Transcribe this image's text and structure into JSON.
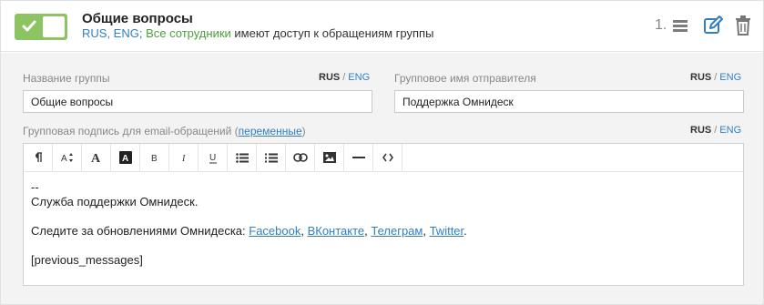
{
  "header": {
    "title": "Общие вопросы",
    "languages": "RUS, ENG;",
    "access_group": "Все сотрудники",
    "access_text": "имеют доступ к обращениям группы",
    "order": "1."
  },
  "form": {
    "group_name": {
      "label": "Название группы",
      "lang_active": "RUS",
      "lang_sep": "/",
      "lang_other": "ENG",
      "value": "Общие вопросы"
    },
    "sender_name": {
      "label": "Групповое имя отправителя",
      "lang_active": "RUS",
      "lang_sep": "/",
      "lang_other": "ENG",
      "value": "Поддержка Омнидеск"
    },
    "signature": {
      "label_prefix": "Групповая подпись для email-обращений (",
      "label_link": "переменные",
      "label_suffix": ")",
      "lang_active": "RUS",
      "lang_sep": "/",
      "lang_other": "ENG",
      "content": {
        "dashes": "--",
        "line1": "Служба поддержки Омнидеск.",
        "follow_text": "Следите за обновлениями Омнидеска: ",
        "links": [
          "Facebook",
          "ВКонтакте",
          "Телеграм",
          "Twitter"
        ],
        "separator": ", ",
        "end": ".",
        "variable": "[previous_messages]"
      }
    }
  },
  "toolbar": {
    "buttons": [
      {
        "name": "paragraph-icon",
        "glyph": "¶"
      },
      {
        "name": "font-size-icon",
        "glyph": "A↕"
      },
      {
        "name": "text-color-icon",
        "glyph": "A"
      },
      {
        "name": "background-color-icon",
        "glyph": "A"
      },
      {
        "name": "bold-icon",
        "glyph": "B"
      },
      {
        "name": "italic-icon",
        "glyph": "I"
      },
      {
        "name": "underline-icon",
        "glyph": "U"
      },
      {
        "name": "unordered-list-icon",
        "glyph": "☰"
      },
      {
        "name": "ordered-list-icon",
        "glyph": "☰"
      },
      {
        "name": "link-icon",
        "glyph": "🔗"
      },
      {
        "name": "image-icon",
        "glyph": "▣"
      },
      {
        "name": "horizontal-rule-icon",
        "glyph": "—"
      },
      {
        "name": "code-view-icon",
        "glyph": "<>"
      }
    ]
  },
  "colors": {
    "toggle_on": "#8dc462",
    "link": "#2f7fc1",
    "access_green": "#4a9e3d"
  }
}
